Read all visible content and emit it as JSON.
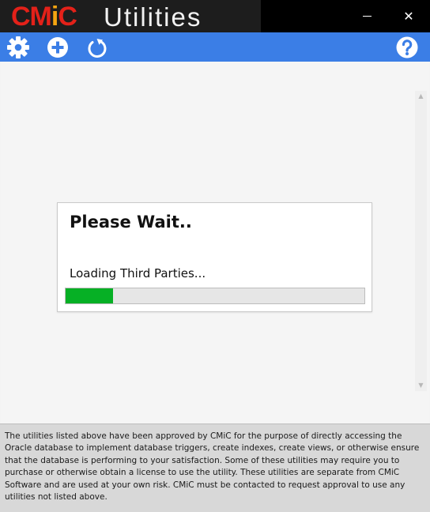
{
  "app": {
    "logo_brand_prefix": "CM",
    "logo_brand_accent": "i",
    "logo_brand_suffix": "C",
    "logo_title": "Utilities"
  },
  "window_controls": {
    "minimize_icon": "minimize-icon",
    "close_icon": "close-icon",
    "close_glyph": "✕"
  },
  "toolbar": {
    "buttons": [
      {
        "icon": "gear-icon"
      },
      {
        "icon": "add-circle-icon"
      },
      {
        "icon": "refresh-icon"
      },
      {
        "icon": "help-circle-icon"
      }
    ],
    "background_color": "#3b7ee6"
  },
  "dialog": {
    "title": "Please Wait..",
    "status": "Loading Third Parties...",
    "progress_fraction": 0.16,
    "progress_color": "#06b025"
  },
  "footer": {
    "disclaimer": "The utilities listed above have been approved by CMiC for the purpose of directly accessing the Oracle database to implement database triggers, create indexes, create views, or otherwise ensure that the database is performing to your satisfaction.  Some of these utilities may require you to purchase or otherwise obtain a license to use the utility.  These utilities are separate from CMiC Software and are used at your own risk.  CMiC must be contacted to request approval to use any utilities not listed above."
  },
  "colors": {
    "brand_red": "#e32119",
    "brand_orange": "#f5a511"
  }
}
